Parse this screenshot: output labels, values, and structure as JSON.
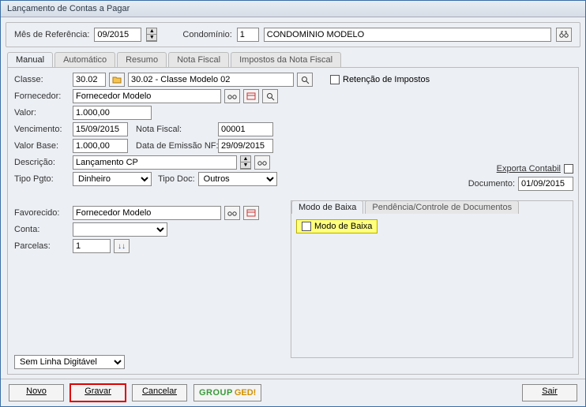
{
  "window": {
    "title": "Lançamento de Contas a Pagar"
  },
  "top": {
    "mes_ref_label": "Mês de Referência:",
    "mes_ref": "09/2015",
    "condominio_label": "Condomínio:",
    "condominio_num": "1",
    "condominio_nome": "CONDOMÍNIO MODELO"
  },
  "tabs": {
    "manual": "Manual",
    "automatico": "Automático",
    "resumo": "Resumo",
    "nota": "Nota Fiscal",
    "impostos": "Impostos da Nota Fiscal"
  },
  "form": {
    "classe_label": "Classe:",
    "classe_code": "30.02",
    "classe_desc": "30.02 - Classe Modelo 02",
    "fornecedor_label": "Fornecedor:",
    "fornecedor": "Fornecedor Modelo",
    "valor_label": "Valor:",
    "valor": "1.000,00",
    "venc_label": "Vencimento:",
    "venc": "15/09/2015",
    "nota_label": "Nota Fiscal:",
    "nota": "00001",
    "valor_base_label": "Valor Base:",
    "valor_base": "1.000,00",
    "emissao_label": "Data de Emissão NF:",
    "emissao": "29/09/2015",
    "descricao_label": "Descrição:",
    "descricao": "Lançamento CP",
    "tipo_pgto_label": "Tipo Pgto:",
    "tipo_pgto": "Dinheiro",
    "tipo_doc_label": "Tipo Doc:",
    "tipo_doc": "Outros",
    "retencao_label": "Retenção de Impostos",
    "exporta_label": "Exporta Contabil",
    "documento_label": "Documento:",
    "documento": "01/09/2015",
    "favorecido_label": "Favorecido:",
    "favorecido": "Fornecedor Modelo",
    "conta_label": "Conta:",
    "conta": "",
    "parcelas_label": "Parcelas:",
    "parcelas": "1",
    "digitavel": "Sem Linha Digitável"
  },
  "inner": {
    "tab_modo": "Modo de Baixa",
    "tab_pend": "Pendência/Controle de Documentos",
    "highlight": "Modo de Baixa"
  },
  "buttons": {
    "novo": "Novo",
    "gravar": "Gravar",
    "cancelar": "Cancelar",
    "ged_group": "GROUP",
    "ged": " GED!",
    "sair": "Sair"
  }
}
